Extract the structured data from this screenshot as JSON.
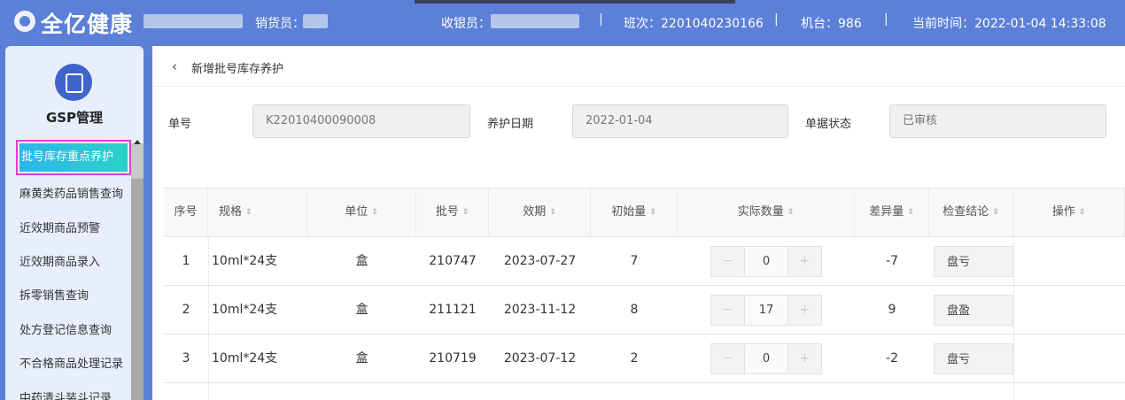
{
  "topbar": {
    "brand": "全亿健康",
    "sales_label": "销货员：",
    "cashier_label": "收银员：",
    "shift": "班次：2201040230166",
    "machine": "机台：986",
    "time": "当前时间：2022-01-04 14:33:08",
    "sep": "|"
  },
  "sidebar": {
    "title": "GSP管理",
    "active": "批号库存重点养护",
    "items": [
      "麻黄类药品销售查询",
      "近效期商品预警",
      "近效期商品录入",
      "拆零销售查询",
      "处方登记信息查询",
      "不合格商品处理记录",
      "中药清斗装斗记录"
    ]
  },
  "page": {
    "back": "‹",
    "title": "新增批号库存养护"
  },
  "form": {
    "order_label": "单号",
    "order_value": "K22010400090008",
    "date_label": "养护日期",
    "date_value": "2022-01-04",
    "status_label": "单据状态",
    "status_value": "已审核"
  },
  "table": {
    "headers": [
      "序号",
      "规格",
      "单位",
      "批号",
      "效期",
      "初始量",
      "实际数量",
      "差异量",
      "检查结论",
      "操作"
    ],
    "sort_glyph": "⇕",
    "rows": [
      {
        "no": "1",
        "spec": "10ml*24支",
        "unit": "盒",
        "batch": "210747",
        "expiry": "2023-07-27",
        "init": "7",
        "actual": "0",
        "diff": "-7",
        "result": "盘亏"
      },
      {
        "no": "2",
        "spec": "10ml*24支",
        "unit": "盒",
        "batch": "211121",
        "expiry": "2023-11-12",
        "init": "8",
        "actual": "17",
        "diff": "9",
        "result": "盘盈"
      },
      {
        "no": "3",
        "spec": "10ml*24支",
        "unit": "盒",
        "batch": "210719",
        "expiry": "2023-07-12",
        "init": "2",
        "actual": "0",
        "diff": "-2",
        "result": "盘亏"
      }
    ],
    "minus": "−",
    "plus": "+"
  },
  "colors": {
    "topbar": "#5c80d7",
    "active_item": "#2bc4d8",
    "highlight_border": "#e03fd0"
  }
}
